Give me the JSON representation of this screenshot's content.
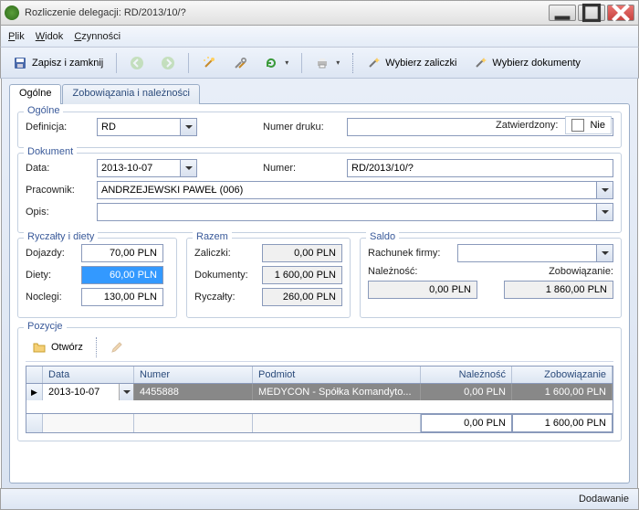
{
  "window": {
    "title": "Rozliczenie delegacji: RD/2013/10/?"
  },
  "menu": {
    "file": "Plik",
    "view": "Widok",
    "actions": "Czynności"
  },
  "toolbar": {
    "save_close": "Zapisz i zamknij",
    "select_advances": "Wybierz zaliczki",
    "select_documents": "Wybierz dokumenty"
  },
  "tabs": {
    "general": "Ogólne",
    "obligations": "Zobowiązania i należności"
  },
  "approved": {
    "label": "Zatwierdzony:",
    "value": "Nie"
  },
  "general": {
    "legend": "Ogólne",
    "definition_label": "Definicja:",
    "definition_value": "RD",
    "print_number_label": "Numer druku:",
    "print_number_value": ""
  },
  "document": {
    "legend": "Dokument",
    "date_label": "Data:",
    "date_value": "2013-10-07",
    "number_label": "Numer:",
    "number_value": "RD/2013/10/?",
    "employee_label": "Pracownik:",
    "employee_value": "ANDRZEJEWSKI PAWEŁ (006)",
    "desc_label": "Opis:",
    "desc_value": ""
  },
  "allowances": {
    "legend": "Ryczałty i diety",
    "commute_label": "Dojazdy:",
    "commute_value": "70,00 PLN",
    "diets_label": "Diety:",
    "diets_value": "60,00 PLN",
    "lodging_label": "Noclegi:",
    "lodging_value": "130,00 PLN"
  },
  "totals": {
    "legend": "Razem",
    "advances_label": "Zaliczki:",
    "advances_value": "0,00 PLN",
    "documents_label": "Dokumenty:",
    "documents_value": "1 600,00 PLN",
    "allowances_label": "Ryczałty:",
    "allowances_value": "260,00 PLN"
  },
  "balance": {
    "legend": "Saldo",
    "company_account_label": "Rachunek firmy:",
    "company_account_value": "",
    "receivable_label": "Należność:",
    "receivable_value": "0,00 PLN",
    "obligation_label": "Zobowiązanie:",
    "obligation_value": "1 860,00 PLN"
  },
  "positions": {
    "legend": "Pozycje",
    "open_label": "Otwórz",
    "columns": {
      "date": "Data",
      "number": "Numer",
      "subject": "Podmiot",
      "receivable": "Należność",
      "obligation": "Zobowiązanie"
    },
    "rows": [
      {
        "date": "2013-10-07",
        "number": "4455888",
        "subject": "MEDYCON - Spółka Komandyto...",
        "receivable": "0,00 PLN",
        "obligation": "1 600,00 PLN"
      }
    ],
    "sum": {
      "receivable": "0,00 PLN",
      "obligation": "1 600,00 PLN"
    }
  },
  "status": {
    "mode": "Dodawanie"
  }
}
